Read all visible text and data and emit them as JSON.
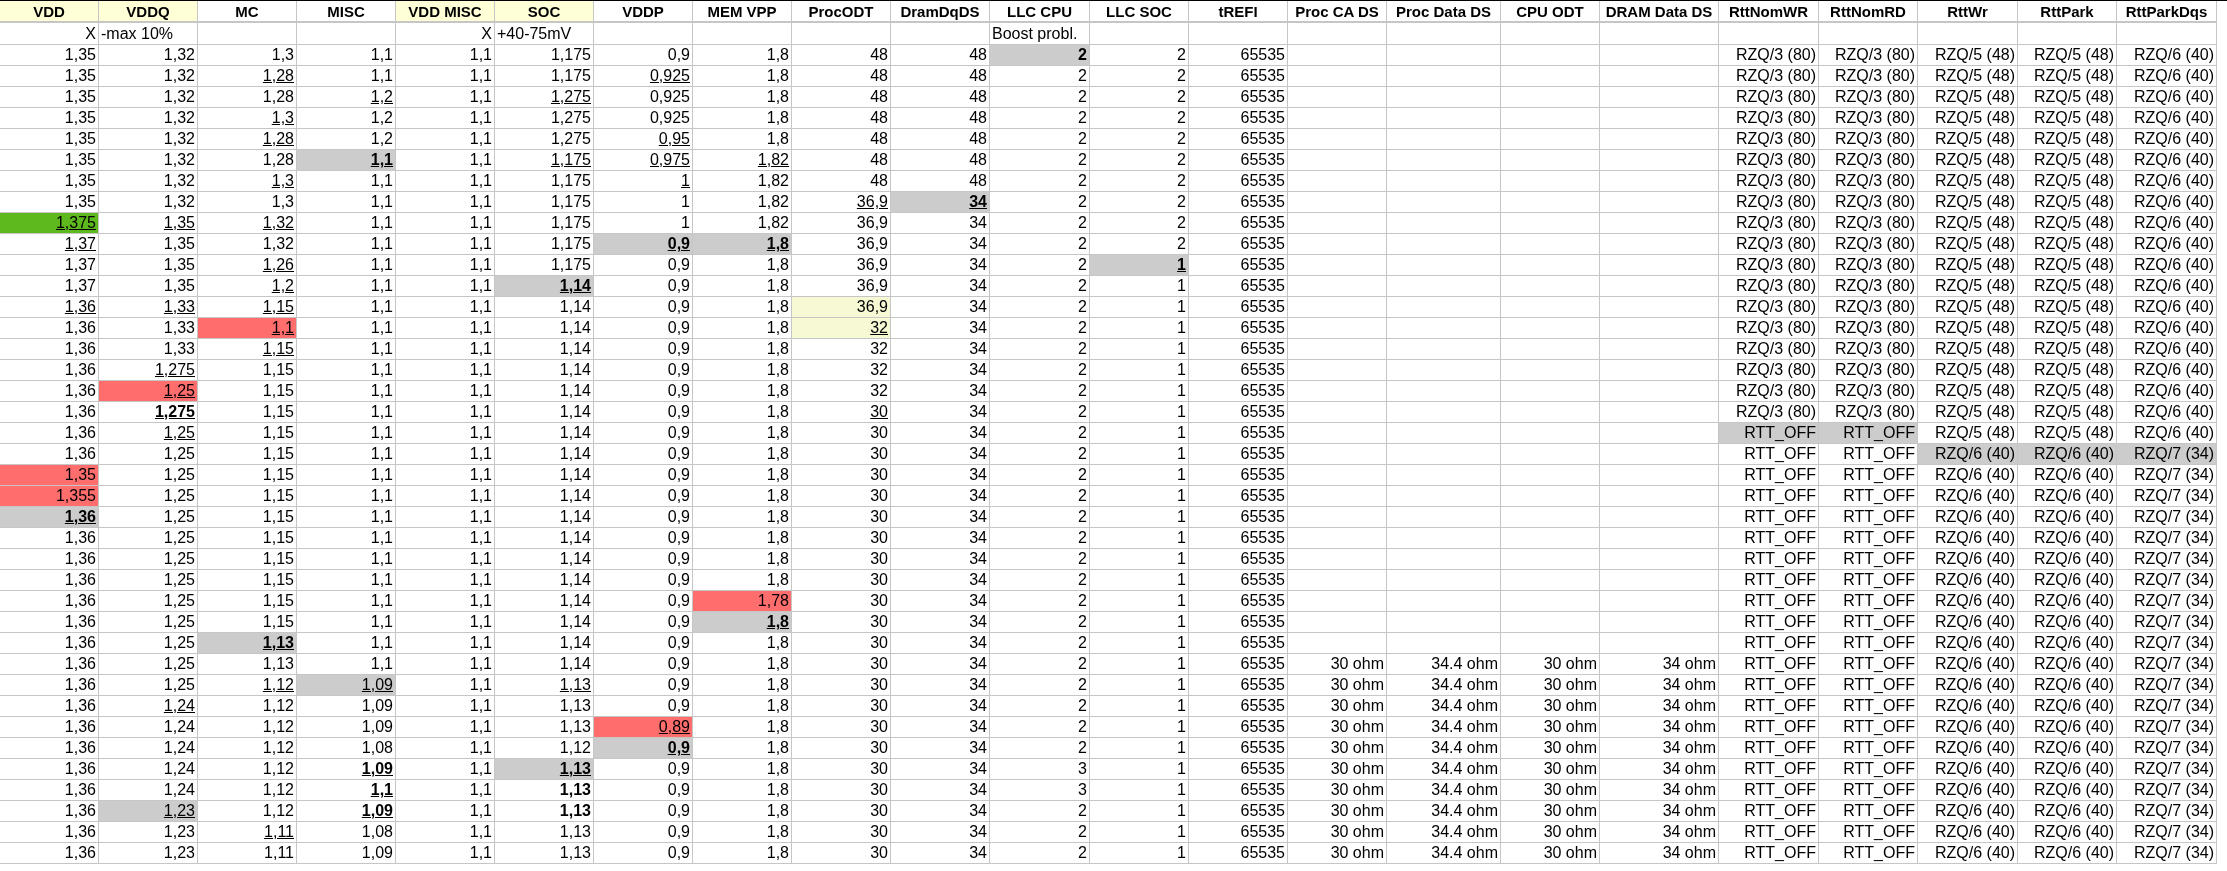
{
  "columns": [
    {
      "label": "VDD",
      "highlighted": true,
      "note": {
        "text": "X",
        "kind": "mark"
      }
    },
    {
      "label": "VDDQ",
      "highlighted": true,
      "note": {
        "text": "-max 10%",
        "kind": "note"
      }
    },
    {
      "label": "MC",
      "highlighted": false
    },
    {
      "label": "MISC",
      "highlighted": false
    },
    {
      "label": "VDD MISC",
      "highlighted": true,
      "note": {
        "text": "X",
        "kind": "mark"
      }
    },
    {
      "label": "SOC",
      "highlighted": true,
      "note": {
        "text": "+40-75mV",
        "kind": "note"
      }
    },
    {
      "label": "VDDP",
      "highlighted": false
    },
    {
      "label": "MEM VPP",
      "highlighted": false
    },
    {
      "label": "ProcODT",
      "highlighted": false
    },
    {
      "label": "DramDqDS",
      "highlighted": false
    },
    {
      "label": "LLC CPU",
      "highlighted": false,
      "note": {
        "text": "Boost probl.",
        "kind": "note"
      }
    },
    {
      "label": "LLC SOC",
      "highlighted": false
    },
    {
      "label": "tREFI",
      "highlighted": false
    },
    {
      "label": "Proc CA DS",
      "highlighted": false
    },
    {
      "label": "Proc Data DS",
      "highlighted": false
    },
    {
      "label": "CPU ODT",
      "highlighted": false
    },
    {
      "label": "DRAM Data DS",
      "highlighted": false
    },
    {
      "label": "RttNomWR",
      "highlighted": false
    },
    {
      "label": "RttNomRD",
      "highlighted": false
    },
    {
      "label": "RttWr",
      "highlighted": false
    },
    {
      "label": "RttPark",
      "highlighted": false
    },
    {
      "label": "RttParkDqs",
      "highlighted": false
    }
  ],
  "rows": [
    {
      "cells": [
        "1,35",
        "1,32",
        "1,3",
        "1,1",
        "1,1",
        "1,175",
        "0,9",
        "1,8",
        "48",
        "48",
        {
          "text": "2",
          "underline": false,
          "bold": true,
          "color": "#cccccc"
        },
        "2",
        "65535"
      ],
      "termination": [
        "RZQ/3 (80)",
        "RZQ/3 (80)",
        "RZQ/5 (48)",
        "RZQ/5 (48)",
        "RZQ/6 (40)"
      ]
    },
    {
      "cells": [
        "1,35",
        "1,32",
        {
          "text": "1,28",
          "underline": true,
          "bold": false
        },
        "1,1",
        "1,1",
        "1,175",
        {
          "text": "0,925",
          "underline": true,
          "bold": false
        },
        "1,8",
        "48",
        "48",
        "2",
        "2",
        "65535"
      ],
      "termination": [
        "RZQ/3 (80)",
        "RZQ/3 (80)",
        "RZQ/5 (48)",
        "RZQ/5 (48)",
        "RZQ/6 (40)"
      ]
    },
    {
      "cells": [
        "1,35",
        "1,32",
        "1,28",
        {
          "text": "1,2",
          "underline": true,
          "bold": false
        },
        "1,1",
        {
          "text": "1,275",
          "underline": true,
          "bold": false
        },
        "0,925",
        "1,8",
        "48",
        "48",
        "2",
        "2",
        "65535"
      ],
      "termination": [
        "RZQ/3 (80)",
        "RZQ/3 (80)",
        "RZQ/5 (48)",
        "RZQ/5 (48)",
        "RZQ/6 (40)"
      ]
    },
    {
      "cells": [
        "1,35",
        "1,32",
        {
          "text": "1,3",
          "underline": true,
          "bold": false
        },
        "1,2",
        "1,1",
        "1,275",
        "0,925",
        "1,8",
        "48",
        "48",
        "2",
        "2",
        "65535"
      ],
      "termination": [
        "RZQ/3 (80)",
        "RZQ/3 (80)",
        "RZQ/5 (48)",
        "RZQ/5 (48)",
        "RZQ/6 (40)"
      ]
    },
    {
      "cells": [
        "1,35",
        "1,32",
        {
          "text": "1,28",
          "underline": true,
          "bold": false
        },
        "1,2",
        "1,1",
        "1,275",
        {
          "text": "0,95",
          "underline": true,
          "bold": false
        },
        "1,8",
        "48",
        "48",
        "2",
        "2",
        "65535"
      ],
      "termination": [
        "RZQ/3 (80)",
        "RZQ/3 (80)",
        "RZQ/5 (48)",
        "RZQ/5 (48)",
        "RZQ/6 (40)"
      ]
    },
    {
      "cells": [
        "1,35",
        "1,32",
        "1,28",
        {
          "text": "1,1",
          "underline": true,
          "bold": true,
          "color": "#cccccc"
        },
        "1,1",
        {
          "text": "1,175",
          "underline": true,
          "bold": false
        },
        {
          "text": "0,975",
          "underline": true,
          "bold": false
        },
        {
          "text": "1,82",
          "underline": true,
          "bold": false
        },
        "48",
        "48",
        "2",
        "2",
        "65535"
      ],
      "termination": [
        "RZQ/3 (80)",
        "RZQ/3 (80)",
        "RZQ/5 (48)",
        "RZQ/5 (48)",
        "RZQ/6 (40)"
      ]
    },
    {
      "cells": [
        "1,35",
        "1,32",
        {
          "text": "1,3",
          "underline": true,
          "bold": false
        },
        "1,1",
        "1,1",
        "1,175",
        {
          "text": "1",
          "underline": true,
          "bold": false
        },
        "1,82",
        "48",
        "48",
        "2",
        "2",
        "65535"
      ],
      "termination": [
        "RZQ/3 (80)",
        "RZQ/3 (80)",
        "RZQ/5 (48)",
        "RZQ/5 (48)",
        "RZQ/6 (40)"
      ]
    },
    {
      "cells": [
        "1,35",
        "1,32",
        "1,3",
        "1,1",
        "1,1",
        "1,175",
        "1",
        "1,82",
        {
          "text": "36,9",
          "underline": true,
          "bold": false
        },
        {
          "text": "34",
          "underline": true,
          "bold": true,
          "color": "#cccccc"
        },
        "2",
        "2",
        "65535"
      ],
      "termination": [
        "RZQ/3 (80)",
        "RZQ/3 (80)",
        "RZQ/5 (48)",
        "RZQ/5 (48)",
        "RZQ/6 (40)"
      ]
    },
    {
      "cells": [
        {
          "text": "1,375",
          "underline": true,
          "bold": false,
          "color": "#5eb91e"
        },
        {
          "text": "1,35",
          "underline": true,
          "bold": false
        },
        {
          "text": "1,32",
          "underline": true,
          "bold": false
        },
        "1,1",
        "1,1",
        "1,175",
        "1",
        "1,82",
        "36,9",
        "34",
        "2",
        "2",
        "65535"
      ],
      "termination": [
        "RZQ/3 (80)",
        "RZQ/3 (80)",
        "RZQ/5 (48)",
        "RZQ/5 (48)",
        "RZQ/6 (40)"
      ]
    },
    {
      "cells": [
        {
          "text": "1,37",
          "underline": true,
          "bold": false
        },
        "1,35",
        "1,32",
        "1,1",
        "1,1",
        "1,175",
        {
          "text": "0,9",
          "underline": true,
          "bold": true,
          "color": "#cccccc"
        },
        {
          "text": "1,8",
          "underline": true,
          "bold": true,
          "color": "#cccccc"
        },
        "36,9",
        "34",
        "2",
        "2",
        "65535"
      ],
      "termination": [
        "RZQ/3 (80)",
        "RZQ/3 (80)",
        "RZQ/5 (48)",
        "RZQ/5 (48)",
        "RZQ/6 (40)"
      ]
    },
    {
      "cells": [
        "1,37",
        "1,35",
        {
          "text": "1,26",
          "underline": true,
          "bold": false
        },
        "1,1",
        "1,1",
        "1,175",
        "0,9",
        "1,8",
        "36,9",
        "34",
        "2",
        {
          "text": "1",
          "underline": true,
          "bold": true,
          "color": "#cccccc"
        },
        "65535"
      ],
      "termination": [
        "RZQ/3 (80)",
        "RZQ/3 (80)",
        "RZQ/5 (48)",
        "RZQ/5 (48)",
        "RZQ/6 (40)"
      ]
    },
    {
      "cells": [
        "1,37",
        "1,35",
        {
          "text": "1,2",
          "underline": true,
          "bold": false
        },
        "1,1",
        "1,1",
        {
          "text": "1,14",
          "underline": true,
          "bold": true,
          "color": "#cccccc"
        },
        "0,9",
        "1,8",
        "36,9",
        "34",
        "2",
        "1",
        "65535"
      ],
      "termination": [
        "RZQ/3 (80)",
        "RZQ/3 (80)",
        "RZQ/5 (48)",
        "RZQ/5 (48)",
        "RZQ/6 (40)"
      ]
    },
    {
      "cells": [
        {
          "text": "1,36",
          "underline": true,
          "bold": false
        },
        {
          "text": "1,33",
          "underline": true,
          "bold": false
        },
        {
          "text": "1,15",
          "underline": true,
          "bold": false
        },
        "1,1",
        "1,1",
        "1,14",
        "0,9",
        "1,8",
        {
          "text": "36,9",
          "underline": false,
          "bold": false,
          "color": "#f6f9d4"
        },
        "34",
        "2",
        "1",
        "65535"
      ],
      "termination": [
        "RZQ/3 (80)",
        "RZQ/3 (80)",
        "RZQ/5 (48)",
        "RZQ/5 (48)",
        "RZQ/6 (40)"
      ]
    },
    {
      "cells": [
        "1,36",
        "1,33",
        {
          "text": "1,1",
          "underline": true,
          "bold": false,
          "color": "#ff6d6d"
        },
        "1,1",
        "1,1",
        "1,14",
        "0,9",
        "1,8",
        {
          "text": "32",
          "underline": true,
          "bold": false,
          "color": "#f6f9d4"
        },
        "34",
        "2",
        "1",
        "65535"
      ],
      "termination": [
        "RZQ/3 (80)",
        "RZQ/3 (80)",
        "RZQ/5 (48)",
        "RZQ/5 (48)",
        "RZQ/6 (40)"
      ]
    },
    {
      "cells": [
        "1,36",
        "1,33",
        {
          "text": "1,15",
          "underline": true,
          "bold": false
        },
        "1,1",
        "1,1",
        "1,14",
        "0,9",
        "1,8",
        "32",
        "34",
        "2",
        "1",
        "65535"
      ],
      "termination": [
        "RZQ/3 (80)",
        "RZQ/3 (80)",
        "RZQ/5 (48)",
        "RZQ/5 (48)",
        "RZQ/6 (40)"
      ]
    },
    {
      "cells": [
        "1,36",
        {
          "text": "1,275",
          "underline": true,
          "bold": false
        },
        "1,15",
        "1,1",
        "1,1",
        "1,14",
        "0,9",
        "1,8",
        "32",
        "34",
        "2",
        "1",
        "65535"
      ],
      "termination": [
        "RZQ/3 (80)",
        "RZQ/3 (80)",
        "RZQ/5 (48)",
        "RZQ/5 (48)",
        "RZQ/6 (40)"
      ]
    },
    {
      "cells": [
        "1,36",
        {
          "text": "1,25",
          "underline": true,
          "bold": false,
          "color": "#ff6d6d"
        },
        "1,15",
        "1,1",
        "1,1",
        "1,14",
        "0,9",
        "1,8",
        "32",
        "34",
        "2",
        "1",
        "65535"
      ],
      "termination": [
        "RZQ/3 (80)",
        "RZQ/3 (80)",
        "RZQ/5 (48)",
        "RZQ/5 (48)",
        "RZQ/6 (40)"
      ]
    },
    {
      "cells": [
        "1,36",
        {
          "text": "1,275",
          "underline": true,
          "bold": true
        },
        "1,15",
        "1,1",
        "1,1",
        "1,14",
        "0,9",
        "1,8",
        {
          "text": "30",
          "underline": true,
          "bold": false
        },
        "34",
        "2",
        "1",
        "65535"
      ],
      "termination": [
        "RZQ/3 (80)",
        "RZQ/3 (80)",
        "RZQ/5 (48)",
        "RZQ/5 (48)",
        "RZQ/6 (40)"
      ]
    },
    {
      "cells": [
        "1,36",
        {
          "text": "1,25",
          "underline": true,
          "bold": false
        },
        "1,15",
        "1,1",
        "1,1",
        "1,14",
        "0,9",
        "1,8",
        "30",
        "34",
        "2",
        "1",
        "65535"
      ],
      "termination": [
        {
          "text": "RTT_OFF",
          "underline": false,
          "bold": false,
          "color": "#cccccc"
        },
        {
          "text": "RTT_OFF",
          "underline": false,
          "bold": false,
          "color": "#cccccc"
        },
        "RZQ/5 (48)",
        "RZQ/5 (48)",
        "RZQ/6 (40)"
      ]
    },
    {
      "cells": [
        "1,36",
        "1,25",
        "1,15",
        "1,1",
        "1,1",
        "1,14",
        "0,9",
        "1,8",
        "30",
        "34",
        "2",
        "1",
        "65535"
      ],
      "termination": [
        "RTT_OFF",
        "RTT_OFF",
        {
          "text": "RZQ/6 (40)",
          "underline": false,
          "bold": false,
          "color": "#cccccc"
        },
        {
          "text": "RZQ/6 (40)",
          "underline": false,
          "bold": false,
          "color": "#cccccc"
        },
        {
          "text": "RZQ/7 (34)",
          "underline": false,
          "bold": false,
          "color": "#cccccc"
        }
      ]
    },
    {
      "cells": [
        {
          "text": "1,35",
          "underline": false,
          "bold": false,
          "color": "#ff6d6d"
        },
        "1,25",
        "1,15",
        "1,1",
        "1,1",
        "1,14",
        "0,9",
        "1,8",
        "30",
        "34",
        "2",
        "1",
        "65535"
      ],
      "termination": [
        "RTT_OFF",
        "RTT_OFF",
        "RZQ/6 (40)",
        "RZQ/6 (40)",
        "RZQ/7 (34)"
      ]
    },
    {
      "cells": [
        {
          "text": "1,355",
          "underline": false,
          "bold": false,
          "color": "#ff6d6d"
        },
        "1,25",
        "1,15",
        "1,1",
        "1,1",
        "1,14",
        "0,9",
        "1,8",
        "30",
        "34",
        "2",
        "1",
        "65535"
      ],
      "termination": [
        "RTT_OFF",
        "RTT_OFF",
        "RZQ/6 (40)",
        "RZQ/6 (40)",
        "RZQ/7 (34)"
      ]
    },
    {
      "cells": [
        {
          "text": "1,36",
          "underline": true,
          "bold": true,
          "color": "#cccccc"
        },
        "1,25",
        "1,15",
        "1,1",
        "1,1",
        "1,14",
        "0,9",
        "1,8",
        "30",
        "34",
        "2",
        "1",
        "65535"
      ],
      "termination": [
        "RTT_OFF",
        "RTT_OFF",
        "RZQ/6 (40)",
        "RZQ/6 (40)",
        "RZQ/7 (34)"
      ]
    },
    {
      "cells": [
        "1,36",
        "1,25",
        "1,15",
        "1,1",
        "1,1",
        "1,14",
        "0,9",
        "1,8",
        "30",
        "34",
        "2",
        "1",
        "65535"
      ],
      "termination": [
        "RTT_OFF",
        "RTT_OFF",
        "RZQ/6 (40)",
        "RZQ/6 (40)",
        "RZQ/7 (34)"
      ]
    },
    {
      "cells": [
        "1,36",
        "1,25",
        "1,15",
        "1,1",
        "1,1",
        "1,14",
        "0,9",
        "1,8",
        "30",
        "34",
        "2",
        "1",
        "65535"
      ],
      "termination": [
        "RTT_OFF",
        "RTT_OFF",
        "RZQ/6 (40)",
        "RZQ/6 (40)",
        "RZQ/7 (34)"
      ]
    },
    {
      "cells": [
        "1,36",
        "1,25",
        "1,15",
        "1,1",
        "1,1",
        "1,14",
        "0,9",
        "1,8",
        "30",
        "34",
        "2",
        "1",
        "65535"
      ],
      "termination": [
        "RTT_OFF",
        "RTT_OFF",
        "RZQ/6 (40)",
        "RZQ/6 (40)",
        "RZQ/7 (34)"
      ]
    },
    {
      "cells": [
        "1,36",
        "1,25",
        "1,15",
        "1,1",
        "1,1",
        "1,14",
        "0,9",
        {
          "text": "1,78",
          "underline": false,
          "bold": false,
          "color": "#ff6d6d"
        },
        "30",
        "34",
        "2",
        "1",
        "65535"
      ],
      "termination": [
        "RTT_OFF",
        "RTT_OFF",
        "RZQ/6 (40)",
        "RZQ/6 (40)",
        "RZQ/7 (34)"
      ]
    },
    {
      "cells": [
        "1,36",
        "1,25",
        "1,15",
        "1,1",
        "1,1",
        "1,14",
        "0,9",
        {
          "text": "1,8",
          "underline": true,
          "bold": true,
          "color": "#cccccc"
        },
        "30",
        "34",
        "2",
        "1",
        "65535"
      ],
      "termination": [
        "RTT_OFF",
        "RTT_OFF",
        "RZQ/6 (40)",
        "RZQ/6 (40)",
        "RZQ/7 (34)"
      ]
    },
    {
      "cells": [
        "1,36",
        "1,25",
        {
          "text": "1,13",
          "underline": true,
          "bold": true,
          "color": "#cccccc"
        },
        "1,1",
        "1,1",
        "1,14",
        "0,9",
        "1,8",
        "30",
        "34",
        "2",
        "1",
        "65535"
      ],
      "termination": [
        "RTT_OFF",
        "RTT_OFF",
        "RZQ/6 (40)",
        "RZQ/6 (40)",
        "RZQ/7 (34)"
      ]
    },
    {
      "cells": [
        "1,36",
        "1,25",
        "1,13",
        "1,1",
        "1,1",
        "1,14",
        "0,9",
        "1,8",
        "30",
        "34",
        "2",
        "1",
        "65535"
      ],
      "drive_strength": [
        "30 ohm",
        "34.4 ohm",
        "30 ohm",
        "34 ohm"
      ],
      "termination": [
        "RTT_OFF",
        "RTT_OFF",
        "RZQ/6 (40)",
        "RZQ/6 (40)",
        "RZQ/7 (34)"
      ]
    },
    {
      "cells": [
        "1,36",
        "1,25",
        {
          "text": "1,12",
          "underline": true,
          "bold": false
        },
        {
          "text": "1,09",
          "underline": true,
          "bold": false,
          "color": "#cccccc"
        },
        "1,1",
        {
          "text": "1,13",
          "underline": true,
          "bold": false
        },
        "0,9",
        "1,8",
        "30",
        "34",
        "2",
        "1",
        "65535"
      ],
      "drive_strength": [
        "30 ohm",
        "34.4 ohm",
        "30 ohm",
        "34 ohm"
      ],
      "termination": [
        "RTT_OFF",
        "RTT_OFF",
        "RZQ/6 (40)",
        "RZQ/6 (40)",
        "RZQ/7 (34)"
      ]
    },
    {
      "cells": [
        "1,36",
        {
          "text": "1,24",
          "underline": true,
          "bold": false
        },
        "1,12",
        "1,09",
        "1,1",
        "1,13",
        "0,9",
        "1,8",
        "30",
        "34",
        "2",
        "1",
        "65535"
      ],
      "drive_strength": [
        "30 ohm",
        "34.4 ohm",
        "30 ohm",
        "34 ohm"
      ],
      "termination": [
        "RTT_OFF",
        "RTT_OFF",
        "RZQ/6 (40)",
        "RZQ/6 (40)",
        "RZQ/7 (34)"
      ]
    },
    {
      "cells": [
        "1,36",
        "1,24",
        "1,12",
        "1,09",
        "1,1",
        "1,13",
        {
          "text": "0,89",
          "underline": true,
          "bold": false,
          "color": "#ff6d6d"
        },
        "1,8",
        "30",
        "34",
        "2",
        "1",
        "65535"
      ],
      "drive_strength": [
        "30 ohm",
        "34.4 ohm",
        "30 ohm",
        "34 ohm"
      ],
      "termination": [
        "RTT_OFF",
        "RTT_OFF",
        "RZQ/6 (40)",
        "RZQ/6 (40)",
        "RZQ/7 (34)"
      ]
    },
    {
      "cells": [
        "1,36",
        "1,24",
        "1,12",
        "1,08",
        "1,1",
        "1,12",
        {
          "text": "0,9",
          "underline": true,
          "bold": true,
          "color": "#cccccc"
        },
        "1,8",
        "30",
        "34",
        "2",
        "1",
        "65535"
      ],
      "drive_strength": [
        "30 ohm",
        "34.4 ohm",
        "30 ohm",
        "34 ohm"
      ],
      "termination": [
        "RTT_OFF",
        "RTT_OFF",
        "RZQ/6 (40)",
        "RZQ/6 (40)",
        "RZQ/7 (34)"
      ]
    },
    {
      "cells": [
        "1,36",
        "1,24",
        "1,12",
        {
          "text": "1,09",
          "underline": true,
          "bold": true
        },
        "1,1",
        {
          "text": "1,13",
          "underline": true,
          "bold": true,
          "color": "#cccccc"
        },
        "0,9",
        "1,8",
        "30",
        "34",
        "3",
        "1",
        "65535"
      ],
      "drive_strength": [
        "30 ohm",
        "34.4 ohm",
        "30 ohm",
        "34 ohm"
      ],
      "termination": [
        "RTT_OFF",
        "RTT_OFF",
        "RZQ/6 (40)",
        "RZQ/6 (40)",
        "RZQ/7 (34)"
      ]
    },
    {
      "cells": [
        "1,36",
        "1,24",
        "1,12",
        {
          "text": "1,1",
          "underline": true,
          "bold": true
        },
        "1,1",
        {
          "text": "1,13",
          "underline": false,
          "bold": true
        },
        "0,9",
        "1,8",
        "30",
        "34",
        "3",
        "1",
        "65535"
      ],
      "drive_strength": [
        "30 ohm",
        "34.4 ohm",
        "30 ohm",
        "34 ohm"
      ],
      "termination": [
        "RTT_OFF",
        "RTT_OFF",
        "RZQ/6 (40)",
        "RZQ/6 (40)",
        "RZQ/7 (34)"
      ]
    },
    {
      "cells": [
        "1,36",
        {
          "text": "1,23",
          "underline": true,
          "bold": false,
          "color": "#cccccc"
        },
        "1,12",
        {
          "text": "1,09",
          "underline": true,
          "bold": true
        },
        "1,1",
        {
          "text": "1,13",
          "underline": false,
          "bold": true
        },
        "0,9",
        "1,8",
        "30",
        "34",
        "2",
        "1",
        "65535"
      ],
      "drive_strength": [
        "30 ohm",
        "34.4 ohm",
        "30 ohm",
        "34 ohm"
      ],
      "termination": [
        "RTT_OFF",
        "RTT_OFF",
        "RZQ/6 (40)",
        "RZQ/6 (40)",
        "RZQ/7 (34)"
      ]
    },
    {
      "cells": [
        "1,36",
        "1,23",
        {
          "text": "1,11",
          "underline": true,
          "bold": false
        },
        "1,08",
        "1,1",
        "1,13",
        "0,9",
        "1,8",
        "30",
        "34",
        "2",
        "1",
        "65535"
      ],
      "drive_strength": [
        "30 ohm",
        "34.4 ohm",
        "30 ohm",
        "34 ohm"
      ],
      "termination": [
        "RTT_OFF",
        "RTT_OFF",
        "RZQ/6 (40)",
        "RZQ/6 (40)",
        "RZQ/7 (34)"
      ]
    },
    {
      "cells": [
        "1,36",
        "1,23",
        "1,11",
        "1,09",
        "1,1",
        "1,13",
        "0,9",
        "1,8",
        "30",
        "34",
        "2",
        "1",
        "65535"
      ],
      "drive_strength": [
        "30 ohm",
        "34.4 ohm",
        "30 ohm",
        "34 ohm"
      ],
      "termination": [
        "RTT_OFF",
        "RTT_OFF",
        "RZQ/6 (40)",
        "RZQ/6 (40)",
        "RZQ/7 (34)"
      ]
    }
  ]
}
